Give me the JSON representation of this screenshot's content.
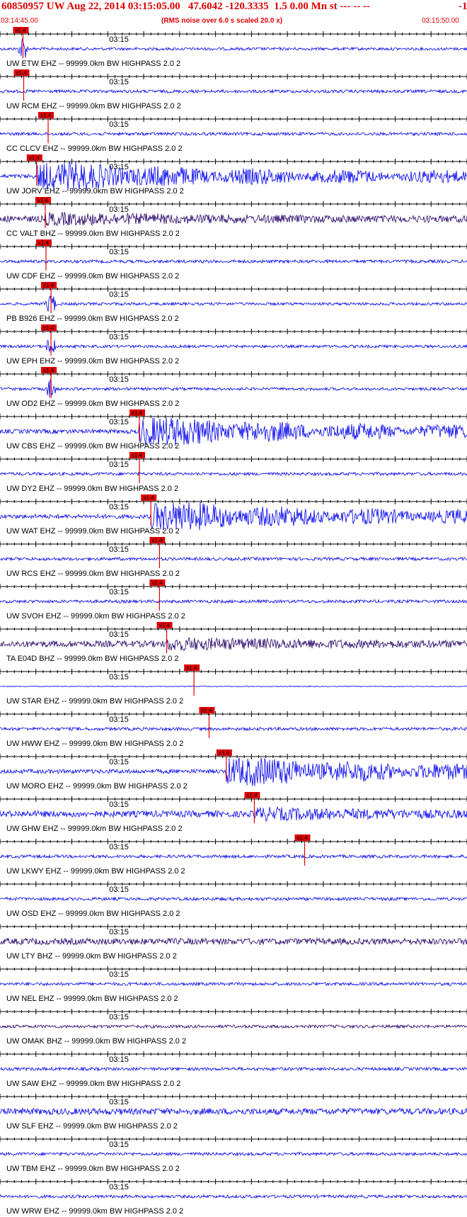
{
  "header": {
    "title": "60850957 UW Aug 22, 2014 03:15:05.00   47.6042 -120.3335  1.5 0.00 Mn st --- -- --",
    "sequence": "-1",
    "start_time": "03:14:45.00",
    "note": "(RMS noise over 6.0 s scaled 20.0 x)",
    "end_time": "03:15:50.00"
  },
  "chart_data": {
    "type": "line",
    "title": "60850957 UW Aug 22, 2014 03:15:05.00",
    "x_range": [
      "03:14:45.00",
      "03:15:50.00"
    ],
    "x_tick_label": "03:15",
    "traces": [
      {
        "label": "UW ETW EHZ -- 99999.0km BW  HIGHPASS  2.0  2",
        "pick": "x1.4",
        "pick_time": "03:14:48.2",
        "color": "#0000ee",
        "activity": "early spike"
      },
      {
        "label": "UW RCM EHZ -- 99999.0km BW  HIGHPASS  2.0  2",
        "pick": "x1.4",
        "pick_time": "03:14:48.3",
        "color": "#0000ee",
        "activity": "low"
      },
      {
        "label": "CC CLCV EHZ -- 99999.0km BW  HIGHPASS  2.0  2",
        "pick": "x1.4",
        "pick_time": "03:14:51.7",
        "color": "#0000ee",
        "activity": "low"
      },
      {
        "label": "UW JORV EHZ -- 99999.0km BW  HIGHPASS  2.0  2",
        "pick": "x1.4",
        "pick_time": "03:14:50.1",
        "color": "#0000ee",
        "activity": "strong"
      },
      {
        "label": "CC VALT BHZ -- 99999.0km BW  HIGHPASS  2.0  2",
        "pick": "x1.4",
        "pick_time": "03:14:51.3",
        "color": "#220066",
        "activity": "moderate"
      },
      {
        "label": "UW CDF EHZ -- 99999.0km BW  HIGHPASS  2.0  2",
        "pick": "x1.4",
        "pick_time": "03:14:51.4",
        "color": "#0000ee",
        "activity": "low"
      },
      {
        "label": "PB B926 EHZ -- 99999.0km BW  HIGHPASS  2.0  2",
        "pick": "x1.4",
        "pick_time": "03:14:52.1",
        "color": "#0000ee",
        "activity": "spike"
      },
      {
        "label": "UW EPH EHZ -- 99999.0km BW  HIGHPASS  2.0  2",
        "pick": "x1.4",
        "pick_time": "03:14:52.1",
        "color": "#0000ee",
        "activity": "spike"
      },
      {
        "label": "UW OD2 EHZ -- 99999.0km BW  HIGHPASS  2.0  2",
        "pick": "x1.4",
        "pick_time": "03:14:52.1",
        "color": "#0000ee",
        "activity": "spike"
      },
      {
        "label": "UW CBS EHZ -- 99999.0km BW  HIGHPASS  2.0  2",
        "pick": "x1.4",
        "pick_time": "03:15:04.4",
        "color": "#0000ee",
        "activity": "strong"
      },
      {
        "label": "UW DY2 EHZ -- 99999.0km BW  HIGHPASS  2.0  2",
        "pick": "x1.4",
        "pick_time": "03:15:04.4",
        "color": "#0000ee",
        "activity": "low"
      },
      {
        "label": "UW WAT EHZ -- 99999.0km BW  HIGHPASS  2.0  2",
        "pick": "x1.4",
        "pick_time": "03:15:06.0",
        "color": "#0000ee",
        "activity": "strong"
      },
      {
        "label": "UW RCS EHZ -- 99999.0km BW  HIGHPASS  2.0  2",
        "pick": "x1.4",
        "pick_time": "03:15:07.2",
        "color": "#0000ee",
        "activity": "low"
      },
      {
        "label": "UW SVOH EHZ -- 99999.0km BW  HIGHPASS  2.0  2",
        "pick": "x1.4",
        "pick_time": "03:15:07.2",
        "color": "#0000ee",
        "activity": "low"
      },
      {
        "label": "TA E04D BHZ -- 99999.0km BW  HIGHPASS  2.0  2",
        "pick": "x1.4",
        "pick_time": "03:15:08.2",
        "color": "#220066",
        "activity": "moderate"
      },
      {
        "label": "UW STAR EHZ -- 99999.0km BW  HIGHPASS  2.0  2",
        "pick": "x1.4",
        "pick_time": "03:15:12.0",
        "color": "#0000ee",
        "activity": "flat"
      },
      {
        "label": "UW HWW EHZ -- 99999.0km BW  HIGHPASS  2.0  2",
        "pick": "x1.4",
        "pick_time": "03:15:14.1",
        "color": "#0000ee",
        "activity": "low"
      },
      {
        "label": "UW MORO EHZ -- 99999.0km BW  HIGHPASS  2.0  2",
        "pick": "x1.4",
        "pick_time": "03:15:16.5",
        "color": "#0000ee",
        "activity": "strong"
      },
      {
        "label": "UW GHW EHZ -- 99999.0km BW  HIGHPASS  2.0  2",
        "pick": "x1.4",
        "pick_time": "03:15:20.4",
        "color": "#0000ee",
        "activity": "moderate"
      },
      {
        "label": "UW LKWY EHZ -- 99999.0km BW  HIGHPASS  2.0  2",
        "pick": "x1.4",
        "pick_time": "03:15:27.4",
        "color": "#0000ee",
        "activity": "low"
      },
      {
        "label": "UW OSD EHZ -- 99999.0km BW  HIGHPASS  2.0  2",
        "pick": "",
        "pick_time": "",
        "color": "#0000ee",
        "activity": "low"
      },
      {
        "label": "UW LTY BHZ -- 99999.0km BW  HIGHPASS  2.0  2",
        "pick": "",
        "pick_time": "",
        "color": "#220066",
        "activity": "moderate"
      },
      {
        "label": "UW NEL EHZ -- 99999.0km BW  HIGHPASS  2.0  2",
        "pick": "",
        "pick_time": "",
        "color": "#0000ee",
        "activity": "low"
      },
      {
        "label": "UW OMAK BHZ -- 99999.0km BW  HIGHPASS  2.0  2",
        "pick": "",
        "pick_time": "",
        "color": "#220066",
        "activity": "low"
      },
      {
        "label": "UW SAW EHZ -- 99999.0km BW  HIGHPASS  2.0  2",
        "pick": "",
        "pick_time": "",
        "color": "#0000ee",
        "activity": "low"
      },
      {
        "label": "UW SLF EHZ -- 99999.0km BW  HIGHPASS  2.0  2",
        "pick": "",
        "pick_time": "",
        "color": "#0000ee",
        "activity": "moderate"
      },
      {
        "label": "UW TBM EHZ -- 99999.0km BW  HIGHPASS  2.0  2",
        "pick": "",
        "pick_time": "",
        "color": "#0000ee",
        "activity": "low"
      },
      {
        "label": "UW WRW EHZ -- 99999.0km BW  HIGHPASS  2.0  2",
        "pick": "",
        "pick_time": "",
        "color": "#0000ee",
        "activity": "low"
      }
    ]
  }
}
